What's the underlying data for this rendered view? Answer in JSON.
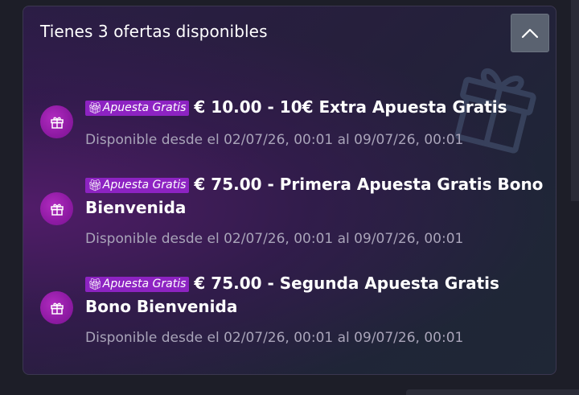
{
  "panel": {
    "title": "Tienes 3 ofertas disponibles",
    "collapse_icon": "chevron-up-icon",
    "background_icon": "gift-icon"
  },
  "offers": [
    {
      "badge": "Apuesta Gratis",
      "title": "€ 10.00 - 10€ Extra Apuesta Gratis",
      "date": "Disponible desde el 02/07/26, 00:01 al 09/07/26, 00:01",
      "icon": "gift-icon"
    },
    {
      "badge": "Apuesta Gratis",
      "title": "€ 75.00 - Primera Apuesta Gratis Bono Bienvenida",
      "date": "Disponible desde el 02/07/26, 00:01 al 09/07/26, 00:01",
      "icon": "gift-icon"
    },
    {
      "badge": "Apuesta Gratis",
      "title": "€ 75.00 - Segunda Apuesta Gratis Bono Bienvenida",
      "date": "Disponible desde el 02/07/26, 00:01 al 09/07/26, 00:01",
      "icon": "gift-icon"
    }
  ],
  "colors": {
    "badge": "#8d23c2",
    "offer_icon": "#9b1fb0",
    "date_text": "#a9a4b9"
  }
}
